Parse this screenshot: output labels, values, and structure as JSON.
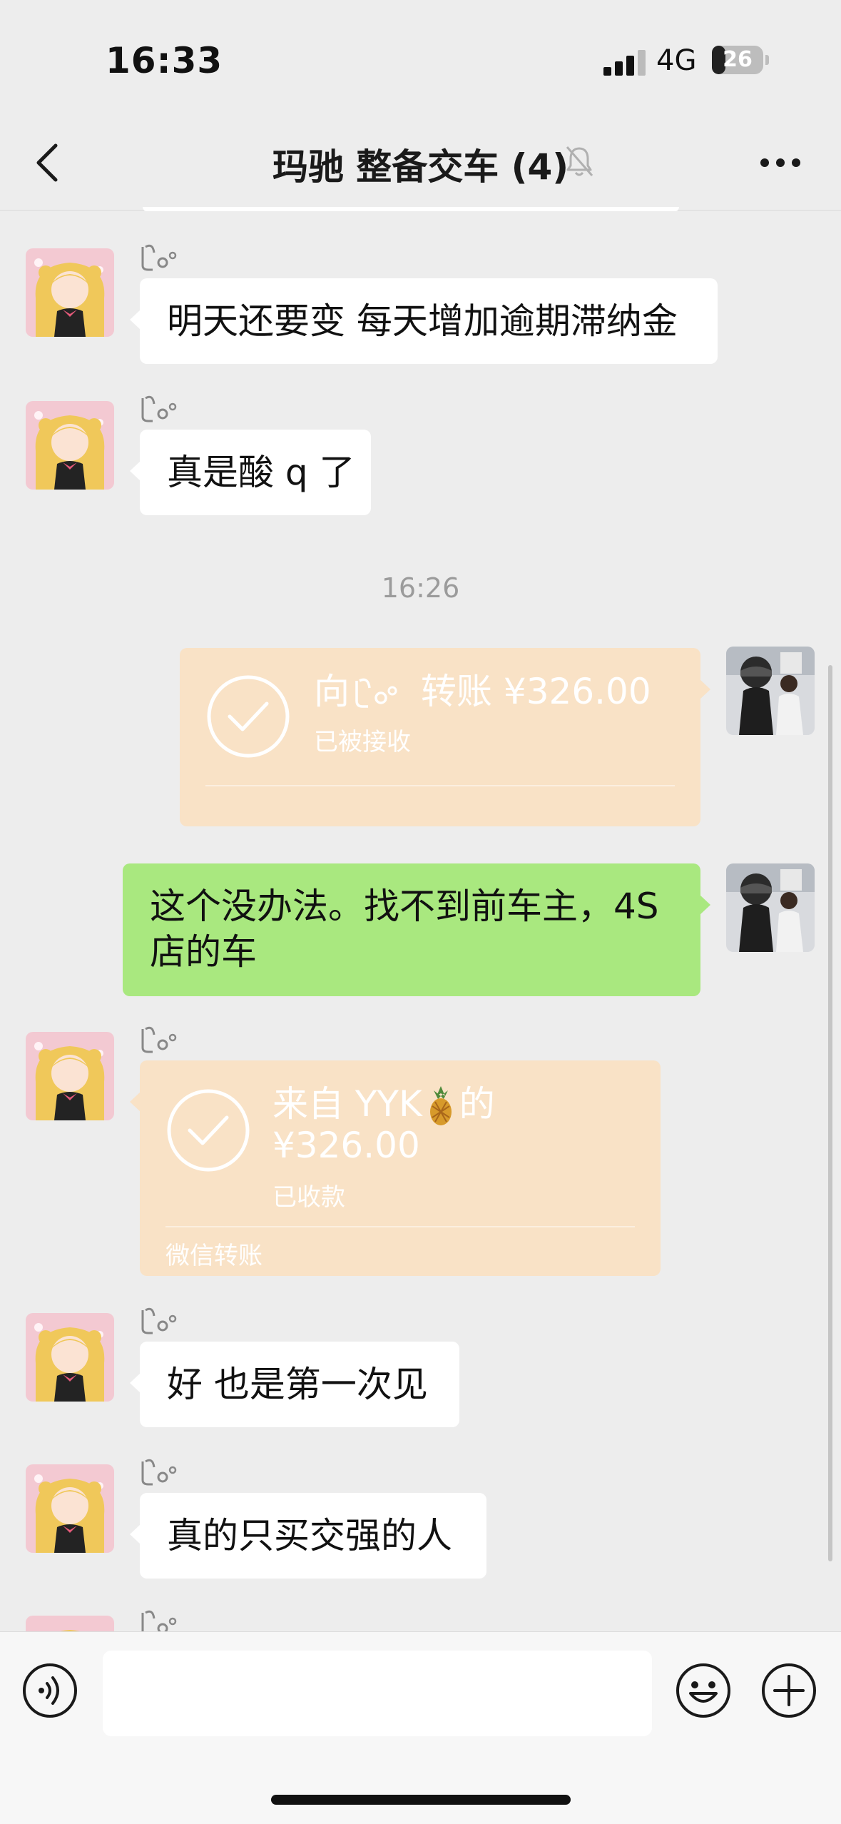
{
  "status_bar": {
    "time": "16:33",
    "network": "4G",
    "battery": "26",
    "battery_level": 0.26
  },
  "nav": {
    "title": "玛驰 整备交车 (4)",
    "back_icon": "chevron-left-icon",
    "mute_icon": "bell-mute-icon",
    "more_icon": "more-dots-icon"
  },
  "messages": [
    {
      "type": "text",
      "side": "left",
      "text": "明天还要变 每天增加逾期滞纳金"
    },
    {
      "type": "text",
      "side": "left",
      "text": "真是酸 q 了"
    },
    {
      "type": "time",
      "text": "16:26"
    },
    {
      "type": "transfer",
      "side": "right",
      "prefix": "向",
      "suffix": "转账 ¥326.00",
      "status": "已被接收"
    },
    {
      "type": "text",
      "side": "right",
      "lines": [
        "这个没办法。找不到前车主，4S",
        "店的车"
      ]
    },
    {
      "type": "transfer",
      "side": "left",
      "line1_prefix": "来自 YYK",
      "line1_suffix": "的",
      "line2": "¥326.00",
      "status": "已收款",
      "footer": "微信转账"
    },
    {
      "type": "text",
      "side": "left",
      "text": "好 也是第一次见"
    },
    {
      "type": "text",
      "side": "left",
      "text": "真的只买交强的人"
    }
  ],
  "input_bar": {
    "voice_icon": "voice-icon",
    "emoji_icon": "emoji-icon",
    "plus_icon": "plus-icon",
    "value": ""
  },
  "colors": {
    "background": "#ededed",
    "bubble_green": "#a9e87f",
    "bubble_white": "#ffffff",
    "transfer_bg": "#f9e2c6"
  }
}
